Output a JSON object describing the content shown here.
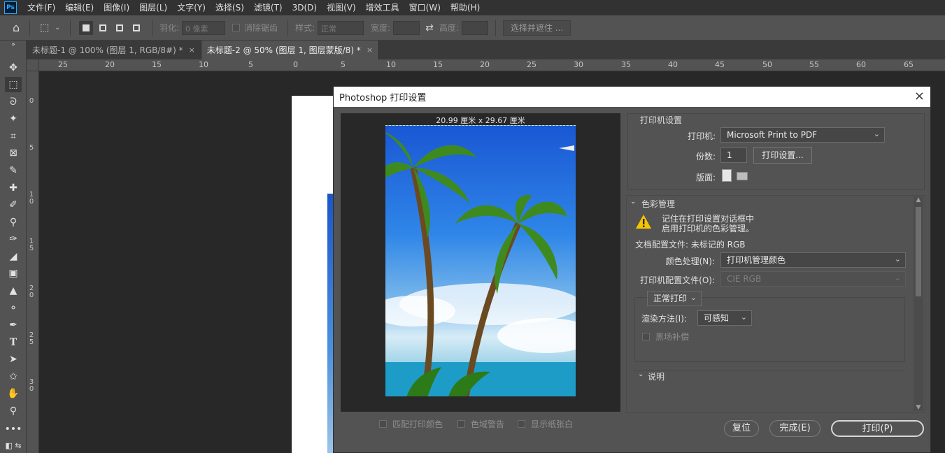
{
  "app": {
    "logo": "Ps",
    "menu": [
      "文件(F)",
      "编辑(E)",
      "图像(I)",
      "图层(L)",
      "文字(Y)",
      "选择(S)",
      "滤镜(T)",
      "3D(D)",
      "视图(V)",
      "增效工具",
      "窗口(W)",
      "帮助(H)"
    ]
  },
  "options": {
    "feather_label": "羽化:",
    "feather_value": "0 像素",
    "antialias_label": "消除锯齿",
    "style_label": "样式:",
    "style_value": "正常",
    "width_label": "宽度:",
    "height_label": "高度:",
    "select_mask_label": "选择并遮住 ..."
  },
  "tabs": [
    {
      "label": "未标题-1 @ 100% (图层 1, RGB/8#) *",
      "close": "×"
    },
    {
      "label": "未标题-2 @ 50% (图层 1, 图层蒙版/8) *",
      "close": "×"
    }
  ],
  "ruler": {
    "top": [
      "25",
      "20",
      "15",
      "10",
      "5",
      "0",
      "5",
      "10",
      "15",
      "20",
      "25",
      "30",
      "35",
      "40",
      "45",
      "50",
      "55",
      "60",
      "65"
    ],
    "left": [
      [
        "0"
      ],
      [
        "5"
      ],
      [
        "1",
        "0"
      ],
      [
        "1",
        "5"
      ],
      [
        "2",
        "0"
      ],
      [
        "2",
        "5"
      ],
      [
        "3",
        "0"
      ]
    ]
  },
  "dialog": {
    "title": "Photoshop 打印设置",
    "close": "×",
    "paper_size": "20.99 厘米 x 29.67 厘米",
    "printer_settings": {
      "section": "打印机设置",
      "printer_label": "打印机:",
      "printer_value": "Microsoft Print to PDF",
      "copies_label": "份数:",
      "copies_value": "1",
      "print_settings_button": "打印设置...",
      "layout_label": "版面:"
    },
    "color_management": {
      "section": "色彩管理",
      "warning_line1": "记住在打印设置对话框中",
      "warning_line2": "启用打印机的色彩管理。",
      "document_profile": "文档配置文件: 未标记的 RGB",
      "color_handling_label": "颜色处理(N):",
      "color_handling_value": "打印机管理颜色",
      "printer_profile_label": "打印机配置文件(O):",
      "printer_profile_value": "CIE RGB",
      "print_mode_value": "正常打印",
      "rendering_label": "渲染方法(I):",
      "rendering_value": "可感知",
      "black_point_label": "黑场补偿"
    },
    "description": {
      "section": "说明"
    },
    "bottom_checks": [
      "匹配打印颜色",
      "色域警告",
      "显示纸张白"
    ],
    "buttons": {
      "reset": "复位",
      "done": "完成(E)",
      "print": "打印(P)"
    }
  }
}
